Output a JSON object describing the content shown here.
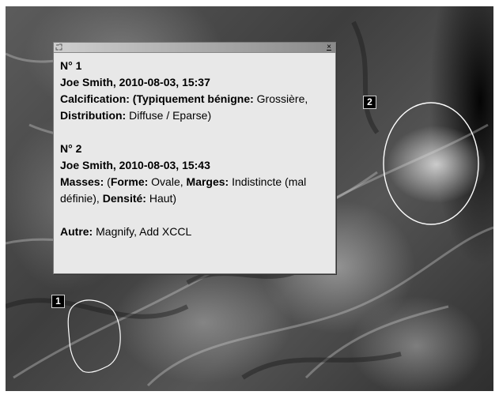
{
  "popup": {
    "close_glyph": "×",
    "findings": [
      {
        "number": "N° 1",
        "header": "Joe Smith, 2010-08-03, 15:37",
        "category": "Calcification:",
        "open_paren": " (",
        "type_label": "Typiquement bénigne:",
        "type_value": " Grossière, ",
        "dist_label": "Distribution:",
        "dist_value": " Diffuse / Eparse)"
      },
      {
        "number": "N° 2",
        "header": "Joe Smith, 2010-08-03, 15:43",
        "category": "Masses:",
        "open_paren": " (",
        "shape_label": "Forme:",
        "shape_value": " Ovale, ",
        "margin_label": "Marges:",
        "margin_value": " Indistincte (mal définie), ",
        "density_label": "Densité:",
        "density_value": " Haut)"
      }
    ],
    "other_label": "Autre:",
    "other_value": " Magnify, Add XCCL"
  },
  "annotations": [
    {
      "label": "1",
      "shape": "freehand"
    },
    {
      "label": "2",
      "shape": "ellipse"
    }
  ]
}
